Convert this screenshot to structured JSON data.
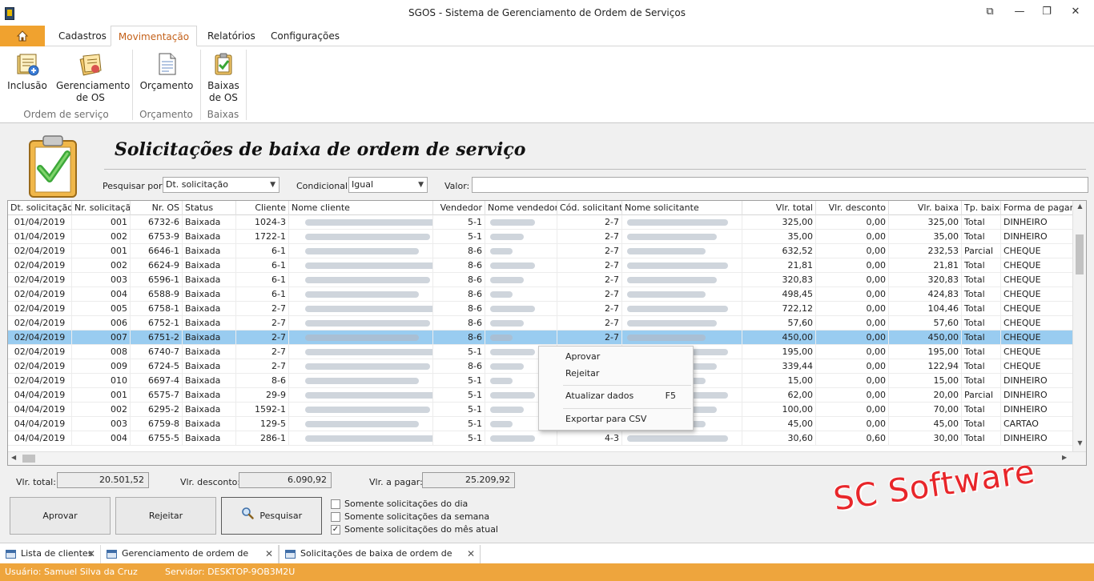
{
  "window": {
    "title": "SGOS - Sistema de Gerenciamento de Ordem de Serviços",
    "restore_glyph": "⧉",
    "minimize_glyph": "—",
    "maximize_glyph": "❐",
    "close_glyph": "✕"
  },
  "ribbon": {
    "tabs": [
      "Cadastros",
      "Movimentação",
      "Relatórios",
      "Configurações"
    ],
    "active_tab": "Movimentação",
    "buttons": {
      "inclusao": "Inclusão",
      "gerenciamento_l1": "Gerenciamento",
      "gerenciamento_l2": "de OS",
      "orcamento": "Orçamento",
      "baixas_l1": "Baixas",
      "baixas_l2": "de OS"
    },
    "groups": {
      "ordem": "Ordem de serviço",
      "orcamento": "Orçamento",
      "baixas": "Baixas"
    }
  },
  "page": {
    "title": "Solicitações de baixa de ordem de serviço"
  },
  "filter": {
    "pesquisar_label": "Pesquisar por:",
    "pesquisar_value": "Dt. solicitação",
    "condicional_label": "Condicional:",
    "condicional_value": "Igual",
    "valor_label": "Valor:",
    "valor_value": ""
  },
  "grid": {
    "columns": [
      "Dt. solicitação",
      "Nr. solicitação",
      "Nr. OS",
      "Status",
      "Cliente",
      "Nome cliente",
      "Vendedor",
      "Nome vendedor",
      "Cód. solicitante",
      "Nome solicitante",
      "Vlr. total",
      "Vlr. desconto",
      "Vlr. baixa",
      "Tp. baixa",
      "Forma de pagame"
    ],
    "selected_row": 8,
    "rows": [
      [
        "01/04/2019",
        "001",
        "6732-6",
        "Baixada",
        "1024-3",
        "5-1",
        "2-7",
        "325,00",
        "0,00",
        "325,00",
        "Total",
        "DINHEIRO"
      ],
      [
        "01/04/2019",
        "002",
        "6753-9",
        "Baixada",
        "1722-1",
        "5-1",
        "2-7",
        "35,00",
        "0,00",
        "35,00",
        "Total",
        "DINHEIRO"
      ],
      [
        "02/04/2019",
        "001",
        "6646-1",
        "Baixada",
        "6-1",
        "8-6",
        "2-7",
        "632,52",
        "0,00",
        "232,53",
        "Parcial",
        "CHEQUE"
      ],
      [
        "02/04/2019",
        "002",
        "6624-9",
        "Baixada",
        "6-1",
        "8-6",
        "2-7",
        "21,81",
        "0,00",
        "21,81",
        "Total",
        "CHEQUE"
      ],
      [
        "02/04/2019",
        "003",
        "6596-1",
        "Baixada",
        "6-1",
        "8-6",
        "2-7",
        "320,83",
        "0,00",
        "320,83",
        "Total",
        "CHEQUE"
      ],
      [
        "02/04/2019",
        "004",
        "6588-9",
        "Baixada",
        "6-1",
        "8-6",
        "2-7",
        "498,45",
        "0,00",
        "424,83",
        "Total",
        "CHEQUE"
      ],
      [
        "02/04/2019",
        "005",
        "6758-1",
        "Baixada",
        "2-7",
        "8-6",
        "2-7",
        "722,12",
        "0,00",
        "104,46",
        "Total",
        "CHEQUE"
      ],
      [
        "02/04/2019",
        "006",
        "6752-1",
        "Baixada",
        "2-7",
        "8-6",
        "2-7",
        "57,60",
        "0,00",
        "57,60",
        "Total",
        "CHEQUE"
      ],
      [
        "02/04/2019",
        "007",
        "6751-2",
        "Baixada",
        "2-7",
        "8-6",
        "2-7",
        "450,00",
        "0,00",
        "450,00",
        "Total",
        "CHEQUE"
      ],
      [
        "02/04/2019",
        "008",
        "6740-7",
        "Baixada",
        "2-7",
        "5-1",
        "",
        "195,00",
        "0,00",
        "195,00",
        "Total",
        "CHEQUE"
      ],
      [
        "02/04/2019",
        "009",
        "6724-5",
        "Baixada",
        "2-7",
        "8-6",
        "",
        "339,44",
        "0,00",
        "122,94",
        "Total",
        "CHEQUE"
      ],
      [
        "02/04/2019",
        "010",
        "6697-4",
        "Baixada",
        "8-6",
        "5-1",
        "",
        "15,00",
        "0,00",
        "15,00",
        "Total",
        "DINHEIRO"
      ],
      [
        "04/04/2019",
        "001",
        "6575-7",
        "Baixada",
        "29-9",
        "5-1",
        "",
        "62,00",
        "0,00",
        "20,00",
        "Parcial",
        "DINHEIRO"
      ],
      [
        "04/04/2019",
        "002",
        "6295-2",
        "Baixada",
        "1592-1",
        "5-1",
        "",
        "100,00",
        "0,00",
        "70,00",
        "Total",
        "DINHEIRO"
      ],
      [
        "04/04/2019",
        "003",
        "6759-8",
        "Baixada",
        "129-5",
        "5-1",
        "",
        "45,00",
        "0,00",
        "45,00",
        "Total",
        "CARTAO"
      ],
      [
        "04/04/2019",
        "004",
        "6755-5",
        "Baixada",
        "286-1",
        "5-1",
        "4-3",
        "30,60",
        "0,60",
        "30,00",
        "Total",
        "DINHEIRO"
      ]
    ]
  },
  "context_menu": {
    "aprovar": "Aprovar",
    "rejeitar": "Rejeitar",
    "atualizar": "Atualizar dados",
    "atualizar_shortcut": "F5",
    "exportar": "Exportar para CSV"
  },
  "totals": {
    "total_label": "Vlr. total:",
    "total_value": "20.501,52",
    "desconto_label": "Vlr. desconto:",
    "desconto_value": "6.090,92",
    "pagar_label": "Vlr. a pagar:",
    "pagar_value": "25.209,92"
  },
  "actions": {
    "aprovar": "Aprovar",
    "rejeitar": "Rejeitar",
    "pesquisar": "Pesquisar"
  },
  "checkboxes": [
    {
      "label": "Somente solicitações do dia",
      "checked": false
    },
    {
      "label": "Somente solicitações da semana",
      "checked": false
    },
    {
      "label": "Somente solicitações do mês atual",
      "checked": true
    }
  ],
  "check_glyph": "✓",
  "watermark": "SC Software",
  "doc_tabs": [
    {
      "label": "Lista de clientes",
      "active": false
    },
    {
      "label": "Gerenciamento de ordem de serviço",
      "active": false
    },
    {
      "label": "Solicitações de baixa de ordem de serviço",
      "active": true
    }
  ],
  "close_glyph": "✕",
  "status": {
    "usuario": "Usuário: Samuel Silva da Cruz",
    "servidor": "Servidor: DESKTOP-9OB3M2U"
  },
  "colors": {
    "accent": "#f0a22f",
    "status_bar": "#eea53d",
    "selection": "#99ccf0",
    "watermark": "#e8262a"
  }
}
